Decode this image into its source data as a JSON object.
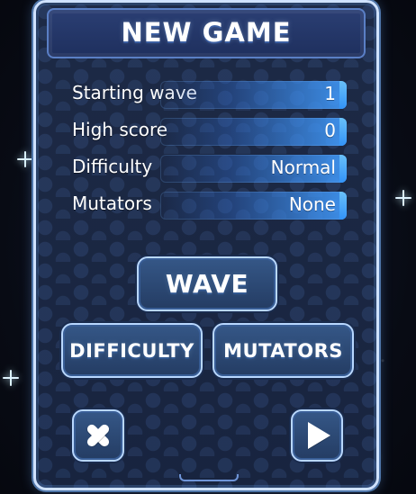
{
  "panel": {
    "title": "NEW GAME"
  },
  "stats": [
    {
      "label": "Starting wave",
      "value": "1"
    },
    {
      "label": "High score",
      "value": "0"
    },
    {
      "label": "Difficulty",
      "value": "Normal"
    },
    {
      "label": "Mutators",
      "value": "None"
    }
  ],
  "buttons": {
    "wave": "WAVE",
    "difficulty": "DIFFICULTY",
    "mutators": "MUTATORS"
  },
  "icons": {
    "close": "close-icon",
    "play": "play-icon",
    "star": "sparkle-icon"
  },
  "colors": {
    "panel_border": "#cfe2ff",
    "panel_fill": "#1a2740",
    "accent_blue": "#42a6ff",
    "text": "#ffffff"
  }
}
